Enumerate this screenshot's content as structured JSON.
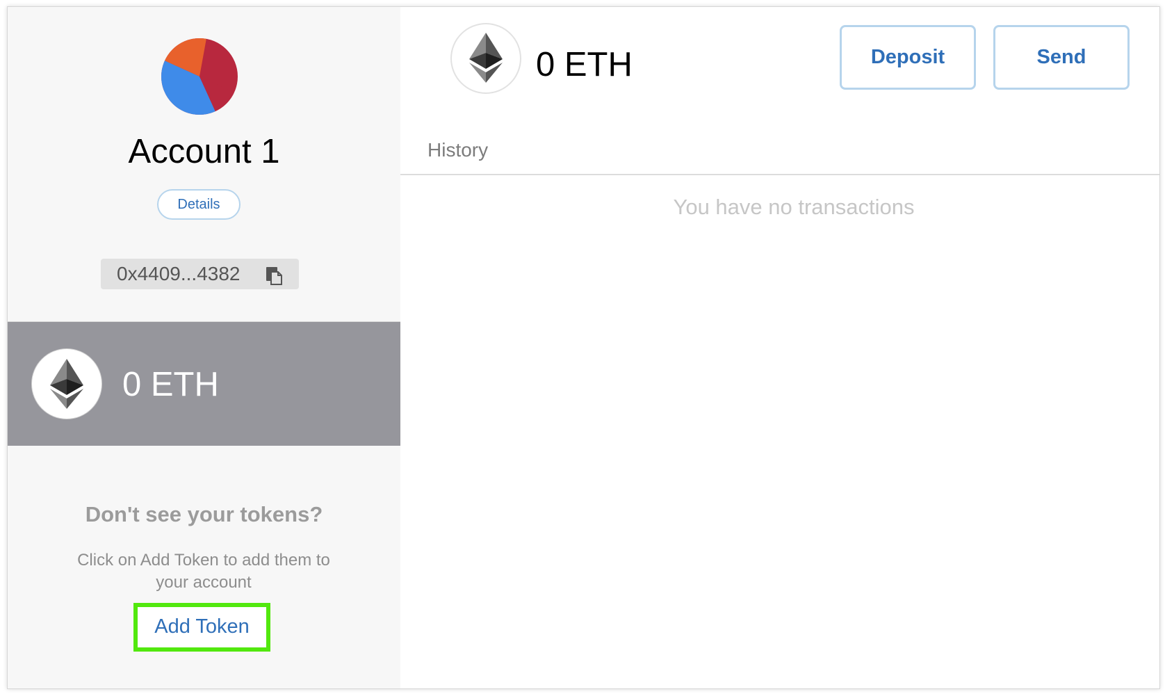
{
  "sidebar": {
    "account_name": "Account 1",
    "details_label": "Details",
    "address": "0x4409...4382",
    "token": {
      "balance": "0 ETH",
      "icon": "ethereum-icon"
    },
    "tokens_help": {
      "title": "Don't see your tokens?",
      "description": "Click on Add Token to add them to your account",
      "add_token_label": "Add Token"
    }
  },
  "main": {
    "balance": "0 ETH",
    "deposit_label": "Deposit",
    "send_label": "Send",
    "history_label": "History",
    "empty_message": "You have no transactions"
  },
  "colors": {
    "accent": "#2f6fb8",
    "button_border": "#b6d4ec",
    "token_row_bg": "#96969c",
    "highlight": "#52e80e",
    "avatar": [
      "#e8612c",
      "#b8283e",
      "#3f8be9"
    ]
  }
}
